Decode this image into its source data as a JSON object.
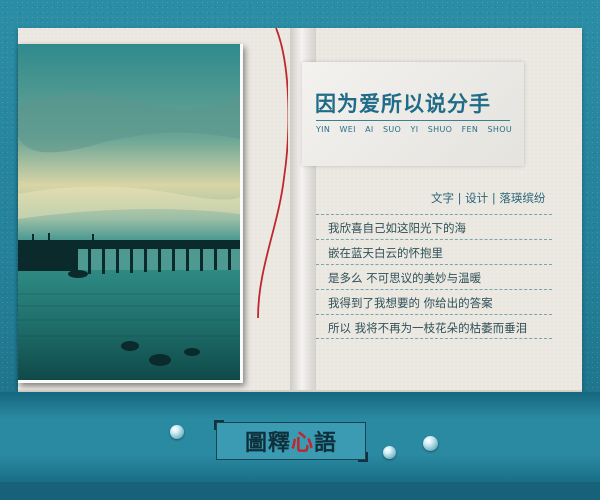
{
  "title": {
    "main": "因为爱所以说分手",
    "pinyin": [
      "YIN",
      "WEI",
      "AI",
      "SUO",
      "YI",
      "SHUO",
      "FEN",
      "SHOU"
    ]
  },
  "credits": "文字 | 设计 | 落瑛缤纷",
  "poem": {
    "lines": [
      "我欣喜自己如这阳光下的海",
      "嵌在蓝天白云的怀抱里",
      "是多么  不可思议的美妙与温暖",
      "我得到了我想要的  你给出的答案",
      "所以  我将不再为一枝花朵的枯萎而垂泪"
    ]
  },
  "logo": {
    "text": "圖釋",
    "highlight": "心",
    "text_end": "語",
    "highlight_color": "#c0272d"
  },
  "colors": {
    "background": "#238098",
    "page": "#ece9e3",
    "title": "#1f6b88",
    "ribbon": "#c0272d"
  }
}
